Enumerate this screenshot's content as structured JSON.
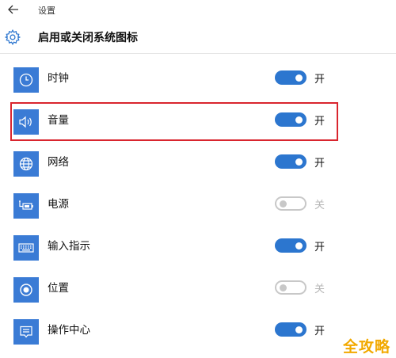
{
  "titlebar": {
    "app_title": "设置"
  },
  "header": {
    "title": "启用或关闭系统图标"
  },
  "items": [
    {
      "label": "时钟",
      "icon": "clock-icon",
      "on": true,
      "state_label": "开"
    },
    {
      "label": "音量",
      "icon": "volume-icon",
      "on": true,
      "state_label": "开"
    },
    {
      "label": "网络",
      "icon": "globe-icon",
      "on": true,
      "state_label": "开"
    },
    {
      "label": "电源",
      "icon": "power-plug-icon",
      "on": false,
      "state_label": "关"
    },
    {
      "label": "输入指示",
      "icon": "keyboard-icon",
      "on": true,
      "state_label": "开"
    },
    {
      "label": "位置",
      "icon": "location-icon",
      "on": false,
      "state_label": "关"
    },
    {
      "label": "操作中心",
      "icon": "action-center-icon",
      "on": true,
      "state_label": "开"
    }
  ],
  "watermark": {
    "text": "全攻略"
  },
  "colors": {
    "tile": "#3a7bd5",
    "toggle_on": "#2c76cf",
    "highlight": "#d9252e",
    "watermark": "#f2a900"
  }
}
